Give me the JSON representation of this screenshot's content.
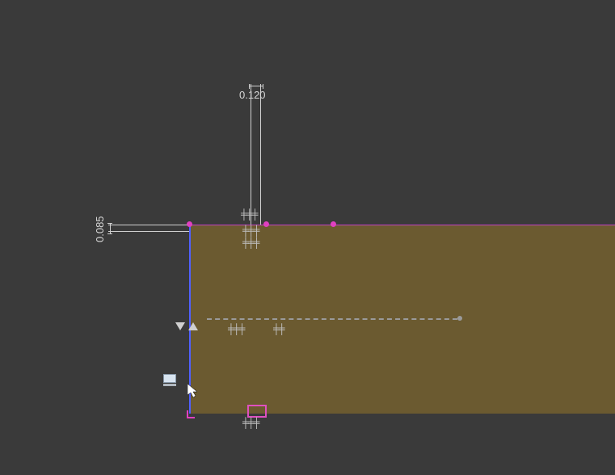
{
  "dimensions": {
    "top": {
      "value": "0.120"
    },
    "left": {
      "value": "0.085"
    }
  },
  "glyphs": {
    "top_upper": "╪╪╪",
    "top_mid": "╪╪╪",
    "top_lower": "╪╪╪",
    "mid_a": "╪╪╪",
    "mid_b": "╪╪",
    "bot": "╪╪╪"
  },
  "symbols": {
    "level_down": "▽",
    "level_up": "△"
  }
}
